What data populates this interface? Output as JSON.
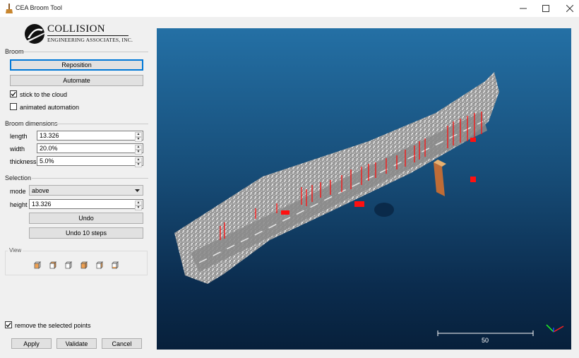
{
  "window": {
    "title": "CEA Broom Tool",
    "minimize_icon": "minimize-icon",
    "maximize_icon": "maximize-icon",
    "close_icon": "close-icon"
  },
  "logo": {
    "name": "COLLISION",
    "subtitle": "ENGINEERING ASSOCIATES, INC."
  },
  "broom": {
    "group_label": "Broom",
    "reposition_label": "Reposition",
    "automate_label": "Automate",
    "stick_to_cloud": {
      "label": "stick to the cloud",
      "checked": true
    },
    "animated_automation": {
      "label": "animated automation",
      "checked": false
    }
  },
  "dimensions": {
    "group_label": "Broom dimensions",
    "length": {
      "label": "length",
      "value": "13.326"
    },
    "width": {
      "label": "width",
      "value": "20.0%"
    },
    "thickness": {
      "label": "thickness",
      "value": "5.0%"
    }
  },
  "selection": {
    "group_label": "Selection",
    "mode": {
      "label": "mode",
      "value": "above"
    },
    "height": {
      "label": "height",
      "value": "13.326"
    },
    "undo_label": "Undo",
    "undo10_label": "Undo 10 steps"
  },
  "view": {
    "group_label": "View",
    "buttons": [
      "view-front-icon",
      "view-top-icon",
      "view-left-icon",
      "view-back-icon",
      "view-right-icon",
      "view-bottom-icon"
    ]
  },
  "footer": {
    "remove_selected": {
      "label": "remove the selected points",
      "checked": true
    },
    "apply_label": "Apply",
    "validate_label": "Validate",
    "cancel_label": "Cancel"
  },
  "viewport": {
    "scale_value": "50",
    "colors": {
      "selected_points": "#ff0000",
      "cloud": "#c8c8c8",
      "bg_top": "#2470a5",
      "bg_bottom": "#07203b"
    }
  }
}
